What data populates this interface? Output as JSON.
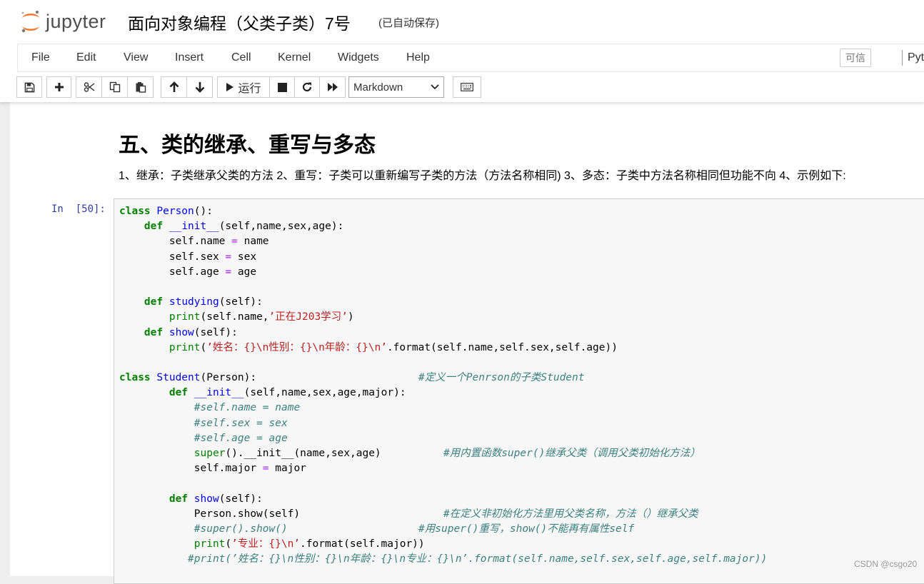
{
  "header": {
    "logo_text": "jupyter",
    "notebook_title": "面向对象编程（父类子类）7号",
    "autosave_status": "(已自动保存)"
  },
  "menu": {
    "items": [
      "File",
      "Edit",
      "View",
      "Insert",
      "Cell",
      "Kernel",
      "Widgets",
      "Help"
    ],
    "trusted": "可信",
    "kernel": "Pyt"
  },
  "toolbar": {
    "run_label": "运行",
    "cell_type": "Markdown",
    "icons": [
      "save-icon",
      "plus-icon",
      "scissors-icon",
      "copy-icon",
      "paste-icon",
      "arrow-up-icon",
      "arrow-down-icon",
      "play-icon",
      "stop-icon",
      "restart-icon",
      "fast-forward-icon",
      "chevron-down-icon",
      "keyboard-icon"
    ]
  },
  "markdown_cell": {
    "heading": "五、类的继承、重写与多态",
    "paragraph": "1、继承：子类继承父类的方法 2、重写：子类可以重新编写子类的方法（方法名称相同) 3、多态：子类中方法名称相同但功能不向 4、示例如下:"
  },
  "code_cell": {
    "prompt": "In  [50]:",
    "lines": [
      [
        [
          "kw",
          "class"
        ],
        [
          "",
          " "
        ],
        [
          "nc",
          "Person"
        ],
        [
          "",
          "():"
        ]
      ],
      [
        [
          "",
          "    "
        ],
        [
          "kw",
          "def"
        ],
        [
          "",
          " "
        ],
        [
          "nf",
          "__init__"
        ],
        [
          "",
          "(self,name,sex,age):"
        ]
      ],
      [
        [
          "",
          "        self.name "
        ],
        [
          "op",
          "="
        ],
        [
          "",
          " name"
        ]
      ],
      [
        [
          "",
          "        self.sex "
        ],
        [
          "op",
          "="
        ],
        [
          "",
          " sex"
        ]
      ],
      [
        [
          "",
          "        self.age "
        ],
        [
          "op",
          "="
        ],
        [
          "",
          " age"
        ]
      ],
      [
        [
          "",
          ""
        ]
      ],
      [
        [
          "",
          "    "
        ],
        [
          "kw",
          "def"
        ],
        [
          "",
          " "
        ],
        [
          "nf",
          "studying"
        ],
        [
          "",
          "(self):"
        ]
      ],
      [
        [
          "",
          "        "
        ],
        [
          "nb",
          "print"
        ],
        [
          "",
          "(self.name,"
        ],
        [
          "s",
          "’正在J203学习’"
        ],
        [
          "",
          ")"
        ]
      ],
      [
        [
          "",
          "    "
        ],
        [
          "kw",
          "def"
        ],
        [
          "",
          " "
        ],
        [
          "nf",
          "show"
        ],
        [
          "",
          "(self):"
        ]
      ],
      [
        [
          "",
          "        "
        ],
        [
          "nb",
          "print"
        ],
        [
          "",
          "("
        ],
        [
          "s",
          "’姓名：{}\\n性别：{}\\n年龄：{}\\n’"
        ],
        [
          "",
          ".format(self.name,self.sex,self.age))"
        ]
      ],
      [
        [
          "",
          ""
        ]
      ],
      [
        [
          "kw",
          "class"
        ],
        [
          "",
          " "
        ],
        [
          "nc",
          "Student"
        ],
        [
          "",
          "(Person):                          "
        ],
        [
          "cm",
          "#定义一个Penrson的子类Student"
        ]
      ],
      [
        [
          "",
          "        "
        ],
        [
          "kw",
          "def"
        ],
        [
          "",
          " "
        ],
        [
          "nf",
          "__init__"
        ],
        [
          "",
          "(self,name,sex,age,major):"
        ]
      ],
      [
        [
          "",
          "            "
        ],
        [
          "cm",
          "#self.name = name"
        ]
      ],
      [
        [
          "",
          "            "
        ],
        [
          "cm",
          "#self.sex = sex"
        ]
      ],
      [
        [
          "",
          "            "
        ],
        [
          "cm",
          "#self.age = age"
        ]
      ],
      [
        [
          "",
          "            "
        ],
        [
          "nb",
          "super"
        ],
        [
          "",
          "().__init__(name,sex,age)          "
        ],
        [
          "cm",
          "#用内置函数super()继承父类（调用父类初始化方法）"
        ]
      ],
      [
        [
          "",
          "            self.major "
        ],
        [
          "op",
          "="
        ],
        [
          "",
          " major"
        ]
      ],
      [
        [
          "",
          ""
        ]
      ],
      [
        [
          "",
          "        "
        ],
        [
          "kw",
          "def"
        ],
        [
          "",
          " "
        ],
        [
          "nf",
          "show"
        ],
        [
          "",
          "(self):"
        ]
      ],
      [
        [
          "",
          "            Person.show(self)                       "
        ],
        [
          "cm",
          "#在定义非初始化方法里用父类名称，方法（）继承父类"
        ]
      ],
      [
        [
          "",
          "            "
        ],
        [
          "cm",
          "#super().show()"
        ],
        [
          "",
          "                     "
        ],
        [
          "cm",
          "#用super()重写，show()不能再有属性self"
        ]
      ],
      [
        [
          "",
          "            "
        ],
        [
          "nb",
          "print"
        ],
        [
          "",
          "("
        ],
        [
          "s",
          "’专业：{}\\n’"
        ],
        [
          "",
          ".format(self.major))"
        ]
      ],
      [
        [
          "",
          "           "
        ],
        [
          "cm",
          "#print(’姓名：{}\\n性别：{}\\n年龄：{}\\n专业：{}\\n’.format(self.name,self.sex,self.age,self.major))"
        ]
      ]
    ]
  },
  "watermark": "CSDN @csgo20"
}
